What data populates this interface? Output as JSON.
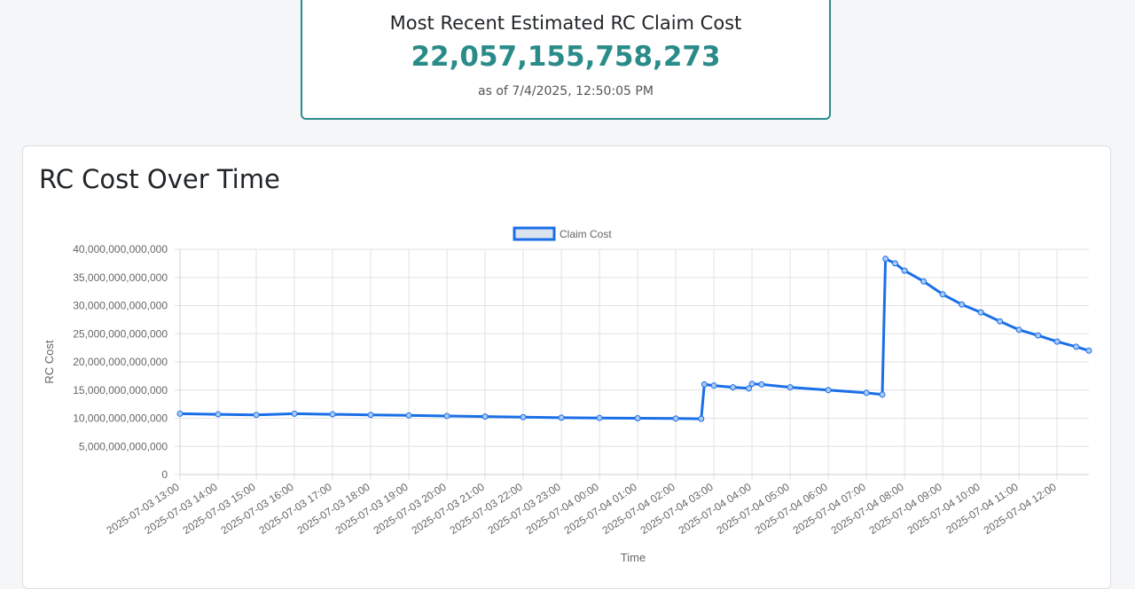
{
  "summary": {
    "title": "Most Recent Estimated RC Claim Cost",
    "value": "22,057,155,758,273",
    "as_of": "as of 7/4/2025, 12:50:05 PM",
    "accent_color": "#2a8c88"
  },
  "chart_section": {
    "heading": "RC Cost Over Time"
  },
  "chart_data": {
    "type": "line",
    "xlabel": "Time",
    "ylabel": "RC Cost",
    "ylim": [
      0,
      40000000000000
    ],
    "yticks": [
      0,
      5000000000000,
      10000000000000,
      15000000000000,
      20000000000000,
      25000000000000,
      30000000000000,
      35000000000000,
      40000000000000
    ],
    "ytick_labels": [
      "0",
      "5,000,000,000,000",
      "10,000,000,000,000",
      "15,000,000,000,000",
      "20,000,000,000,000",
      "25,000,000,000,000",
      "30,000,000,000,000",
      "35,000,000,000,000",
      "40,000,000,000,000"
    ],
    "xlim": [
      "2025-07-03 13:00",
      "2025-07-04 12:50"
    ],
    "xtick_labels": [
      "2025-07-03 13:00",
      "2025-07-03 14:00",
      "2025-07-03 15:00",
      "2025-07-03 16:00",
      "2025-07-03 17:00",
      "2025-07-03 18:00",
      "2025-07-03 19:00",
      "2025-07-03 20:00",
      "2025-07-03 21:00",
      "2025-07-03 22:00",
      "2025-07-03 23:00",
      "2025-07-04 00:00",
      "2025-07-04 01:00",
      "2025-07-04 02:00",
      "2025-07-04 03:00",
      "2025-07-04 04:00",
      "2025-07-04 05:00",
      "2025-07-04 06:00",
      "2025-07-04 07:00",
      "2025-07-04 08:00",
      "2025-07-04 09:00",
      "2025-07-04 10:00",
      "2025-07-04 11:00",
      "2025-07-04 12:00"
    ],
    "grid": true,
    "legend_placement": "top-center",
    "series": [
      {
        "name": "Claim Cost",
        "color": "#1a6fe8",
        "fill_color": "#dbe3ef",
        "points": [
          [
            "2025-07-03 13:00",
            10800000000000
          ],
          [
            "2025-07-03 14:00",
            10700000000000
          ],
          [
            "2025-07-03 15:00",
            10600000000000
          ],
          [
            "2025-07-03 16:00",
            10800000000000
          ],
          [
            "2025-07-03 17:00",
            10700000000000
          ],
          [
            "2025-07-03 18:00",
            10600000000000
          ],
          [
            "2025-07-03 19:00",
            10500000000000
          ],
          [
            "2025-07-03 20:00",
            10400000000000
          ],
          [
            "2025-07-03 21:00",
            10300000000000
          ],
          [
            "2025-07-03 22:00",
            10200000000000
          ],
          [
            "2025-07-03 23:00",
            10100000000000
          ],
          [
            "2025-07-04 00:00",
            10050000000000
          ],
          [
            "2025-07-04 01:00",
            10000000000000
          ],
          [
            "2025-07-04 02:00",
            9950000000000
          ],
          [
            "2025-07-04 02:40",
            9900000000000
          ],
          [
            "2025-07-04 02:45",
            16000000000000
          ],
          [
            "2025-07-04 03:00",
            15800000000000
          ],
          [
            "2025-07-04 03:30",
            15500000000000
          ],
          [
            "2025-07-04 03:55",
            15300000000000
          ],
          [
            "2025-07-04 04:00",
            16100000000000
          ],
          [
            "2025-07-04 04:15",
            16000000000000
          ],
          [
            "2025-07-04 05:00",
            15500000000000
          ],
          [
            "2025-07-04 06:00",
            15000000000000
          ],
          [
            "2025-07-04 07:00",
            14500000000000
          ],
          [
            "2025-07-04 07:25",
            14200000000000
          ],
          [
            "2025-07-04 07:30",
            38300000000000
          ],
          [
            "2025-07-04 07:45",
            37500000000000
          ],
          [
            "2025-07-04 08:00",
            36200000000000
          ],
          [
            "2025-07-04 08:30",
            34300000000000
          ],
          [
            "2025-07-04 09:00",
            32000000000000
          ],
          [
            "2025-07-04 09:30",
            30200000000000
          ],
          [
            "2025-07-04 10:00",
            28800000000000
          ],
          [
            "2025-07-04 10:30",
            27200000000000
          ],
          [
            "2025-07-04 11:00",
            25700000000000
          ],
          [
            "2025-07-04 11:30",
            24700000000000
          ],
          [
            "2025-07-04 12:00",
            23600000000000
          ],
          [
            "2025-07-04 12:30",
            22700000000000
          ],
          [
            "2025-07-04 12:50",
            22000000000000
          ]
        ]
      }
    ]
  }
}
